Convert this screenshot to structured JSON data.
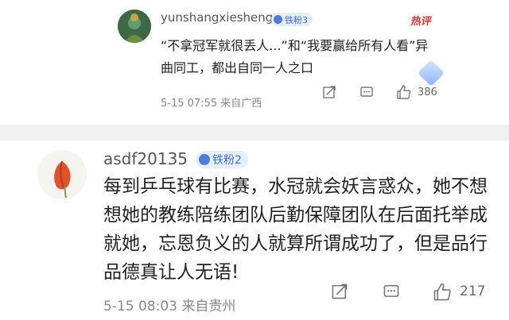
{
  "comments": [
    {
      "username": "yunshangxiesheng",
      "badge": "铁粉3",
      "hot_tag": "热评",
      "text": "“不拿冠军就很丢人...”和“我要赢给所有人看”异曲同工，都出自同一人之口",
      "time": "5-15 07:55",
      "location": "来自广西",
      "likes": "386"
    },
    {
      "username": "asdf20135",
      "badge": "铁粉2",
      "text": "每到乒乓球有比赛，水冠就会妖言惑众，她不想想她的教练陪练团队后勤保障团队在后面托举成就她，忘恩负义的人就算所谓成功了，但是品行品德真让人无语!",
      "time": "5-15 08:03",
      "location": "来自贵州",
      "likes": "217"
    }
  ],
  "icons": {
    "share": "share-icon",
    "comment": "comment-icon",
    "like": "thumbs-up-icon",
    "badge": "fan-badge-icon"
  },
  "colors": {
    "badge_text": "#3c6fd7",
    "badge_bg": "#e7eefb",
    "hot": "#e8322b",
    "divider": "#f0f0f0"
  }
}
